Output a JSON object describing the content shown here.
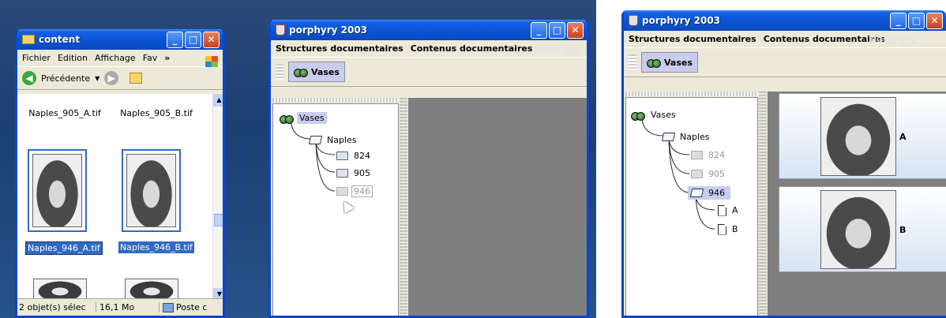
{
  "explorer": {
    "title": "content",
    "menu": [
      "Fichier",
      "Edition",
      "Affichage",
      "Fav",
      "»"
    ],
    "back_label": "Précédente",
    "files": [
      {
        "name": "Naples_905_A.tif",
        "selected": false
      },
      {
        "name": "Naples_905_B.tif",
        "selected": false
      },
      {
        "name": "Naples_946_A.tif",
        "selected": true
      },
      {
        "name": "Naples_946_B.tif",
        "selected": true
      }
    ],
    "status_count": "2 objet(s) sélec",
    "status_size": "16,1 Mo",
    "status_loc": "Poste c"
  },
  "porphyry1": {
    "title": "porphyry 2003",
    "menu": [
      "Structures documentaires",
      "Contenus documentaires"
    ],
    "logo": "porphyry",
    "toolbar_label": "Vases",
    "tree": {
      "root": "Vases",
      "naples": "Naples",
      "n824": "824",
      "n905": "905",
      "n946": "946"
    }
  },
  "porphyry2": {
    "title": "porphyry 2003",
    "menu": [
      "Structures documentaires",
      "Contenus documentaires"
    ],
    "logo": "porphyry",
    "toolbar_label": "Vases",
    "tree": {
      "root": "Vases",
      "naples": "Naples",
      "n824": "824",
      "n905": "905",
      "n946": "946",
      "a": "A",
      "b": "B"
    },
    "previews": [
      "A",
      "B"
    ]
  },
  "colors": {
    "xp_blue": "#0a46c8",
    "selection": "#316ac5",
    "tree_sel": "#c8cdf0"
  }
}
